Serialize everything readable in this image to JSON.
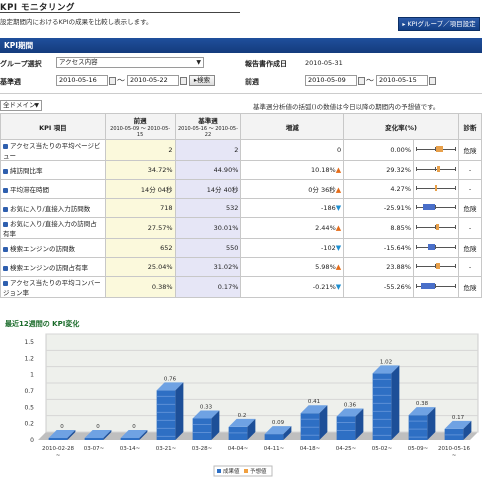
{
  "page": {
    "title": "KPI モニタリング",
    "description": "設定期間内におけるKPIの成果を比較し表示します。",
    "top_button": "KPIグループ／項目設定"
  },
  "period": {
    "band_title": "KPI期間",
    "group_label": "グループ選択",
    "group_value": "アクセス内容",
    "report_date_label": "報告書作成日",
    "report_date": "2010-05-31",
    "base_week_label": "基準週",
    "base_start": "2010-05-16",
    "base_end": "2010-05-22",
    "search_button": "検索",
    "prev_week_label": "前週",
    "prev_start": "2010-05-09",
    "prev_end": "2010-05-15",
    "tilde": "～"
  },
  "filter": {
    "domain_select": "全ドメイン",
    "note": "基準週分析値の括弧()の数値は今日以降の期間内の予想値です。"
  },
  "table": {
    "col_kpi": "KPI 項目",
    "col_prev": "前週",
    "col_prev_range": "2010-05-09 ～ 2010-05-15",
    "col_base": "基準週",
    "col_base_range": "2010-05-16 ～ 2010-05-22",
    "col_change": "増減",
    "col_rate": "変化率(%)",
    "col_diag": "診断",
    "rows": [
      {
        "name": "アクセス当たりの平均ページビュー",
        "prev": "2",
        "base": "2",
        "change": "0",
        "dir": "",
        "rate": "0.00%",
        "diag": "危険"
      },
      {
        "name": "純訪問比率",
        "prev": "34.72%",
        "base": "44.90%",
        "change": "10.18%",
        "dir": "up",
        "rate": "29.32%",
        "diag": "-"
      },
      {
        "name": "平均滞在時間",
        "prev": "14分 04秒",
        "base": "14分 40秒",
        "change": "0分 36秒",
        "dir": "up",
        "rate": "4.27%",
        "diag": "-"
      },
      {
        "name": "お気に入り/直接入力訪問数",
        "prev": "718",
        "base": "532",
        "change": "-186",
        "dir": "dn",
        "rate": "-25.91%",
        "diag": "危険"
      },
      {
        "name": "お気に入り/直接入力の訪問占有率",
        "prev": "27.57%",
        "base": "30.01%",
        "change": "2.44%",
        "dir": "up",
        "rate": "8.85%",
        "diag": "-"
      },
      {
        "name": "検索エンジンの訪問数",
        "prev": "652",
        "base": "550",
        "change": "-102",
        "dir": "dn",
        "rate": "-15.64%",
        "diag": "危険"
      },
      {
        "name": "検索エンジンの訪問占有率",
        "prev": "25.04%",
        "base": "31.02%",
        "change": "5.98%",
        "dir": "up",
        "rate": "23.88%",
        "diag": "-"
      },
      {
        "name": "アクセス当たりの平均コンバージョン率",
        "prev": "0.38%",
        "base": "0.17%",
        "change": "-0.21%",
        "dir": "dn",
        "rate": "-55.26%",
        "diag": "危険"
      }
    ]
  },
  "chart_section_title": "最近12週間の KPI変化",
  "chart_data": {
    "type": "bar",
    "categories": [
      "2010-02-28~",
      "03-07~",
      "03-14~",
      "03-21~",
      "03-28~",
      "04-04~",
      "04-11~",
      "04-18~",
      "04-25~",
      "05-02~",
      "05-09~",
      "2010-05-16~"
    ],
    "series": [
      {
        "name": "成果値",
        "values": [
          0,
          0,
          0,
          0.76,
          0.33,
          0.2,
          0.09,
          0.41,
          0.36,
          1.02,
          0.38,
          0.17
        ]
      }
    ],
    "value_labels": [
      "0",
      "0",
      "0",
      "0.76",
      "0.33",
      "0.2",
      "0.09",
      "0.41",
      "0.36",
      "1.02",
      "0.38",
      "0.17"
    ],
    "y_ticks": [
      "0",
      "0.2",
      "0.5",
      "0.7",
      "1",
      "1.2",
      "1.5"
    ],
    "ylim": [
      0,
      1.5
    ],
    "legend": [
      "成果値",
      "予想値"
    ],
    "legend_position": "bottom",
    "grid": true,
    "colors": {
      "bar": "#2e6fc4",
      "forecast": "#f0a040"
    }
  },
  "colors": {
    "band": "#1f4f9c",
    "prev_bg": "#fbf9dc",
    "base_bg": "#e6e6f6",
    "up": "#e46c1a",
    "down": "#1f8fd0",
    "section": "#1a6b2a"
  }
}
